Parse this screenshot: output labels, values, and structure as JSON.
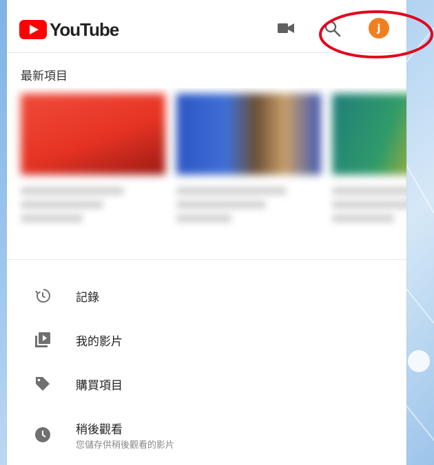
{
  "app": {
    "name": "YouTube"
  },
  "header": {
    "logo_text": "YouTube",
    "avatar_initial": "j",
    "icons": [
      "video-camera-icon",
      "search-icon"
    ]
  },
  "recent": {
    "title": "最新項目",
    "items": [
      {
        "thumbnail_color": "#e63323"
      },
      {
        "thumbnail_color": "#3f6fd7"
      },
      {
        "thumbnail_color": "#2f9b6a"
      }
    ]
  },
  "menu": {
    "items": [
      {
        "label": "記錄",
        "icon": "history-icon"
      },
      {
        "label": "我的影片",
        "icon": "my-videos-icon"
      },
      {
        "label": "購買項目",
        "icon": "tag-icon"
      },
      {
        "label": "稍後觀看",
        "sublabel": "您儲存供稍後觀看的影片",
        "icon": "clock-icon"
      }
    ]
  },
  "colors": {
    "brand_red": "#ff0000",
    "avatar": "#f07f21",
    "annotation_ring": "#e4001b"
  }
}
